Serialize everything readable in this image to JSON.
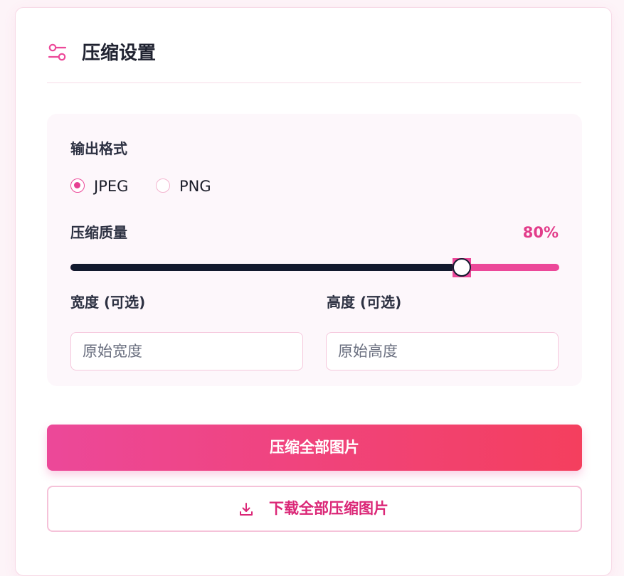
{
  "settings": {
    "title": "压缩设置",
    "title_icon": "sliders-icon",
    "accent_color": "#ec4899",
    "output_format": {
      "label": "输出格式",
      "options": [
        {
          "label": "JPEG",
          "checked": true
        },
        {
          "label": "PNG",
          "checked": false
        }
      ]
    },
    "quality": {
      "label": "压缩质量",
      "value_text": "80%",
      "value": 0.8
    },
    "width": {
      "label": "宽度 (可选)",
      "placeholder": "原始宽度"
    },
    "height": {
      "label": "高度 (可选)",
      "placeholder": "原始高度"
    }
  },
  "actions": {
    "compress_all_label": "压缩全部图片",
    "download_all_label": "下载全部压缩图片",
    "download_icon": "download-icon"
  }
}
